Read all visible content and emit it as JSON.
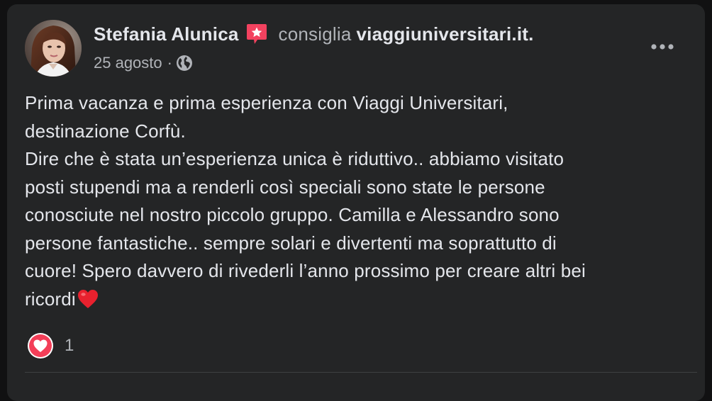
{
  "post": {
    "author": "Stefania Alunica",
    "verb": "consiglia",
    "page": "viaggiuniversitari.it",
    "page_suffix": ".",
    "date": "25 agosto",
    "separator": "·",
    "text_lines": [
      "Prima vacanza e prima esperienza con Viaggi Universitari,",
      "destinazione Corfù.",
      "Dire che è stata un’esperienza unica è riduttivo.. abbiamo visitato",
      "posti stupendi ma a renderli così speciali sono state le persone",
      "conosciute nel nostro piccolo gruppo. Camilla e Alessandro sono",
      "persone fantastiche.. sempre solari e divertenti ma soprattutto di",
      "cuore! Spero davvero di rivederli l’anno prossimo per creare altri bei",
      "ricordi"
    ],
    "reaction_count": "1"
  },
  "icons": {
    "badge": "recommendation-star-icon",
    "privacy": "globe-icon",
    "more": "more-options-icon",
    "emoji": "red-heart-emoji",
    "reaction": "love-reaction-icon"
  },
  "colors": {
    "card": "#242526",
    "page_bg": "#111112",
    "primary_text": "#e4e6eb",
    "secondary_text": "#b0b3b8",
    "badge": "#f3425f",
    "love": "#f33e58"
  }
}
